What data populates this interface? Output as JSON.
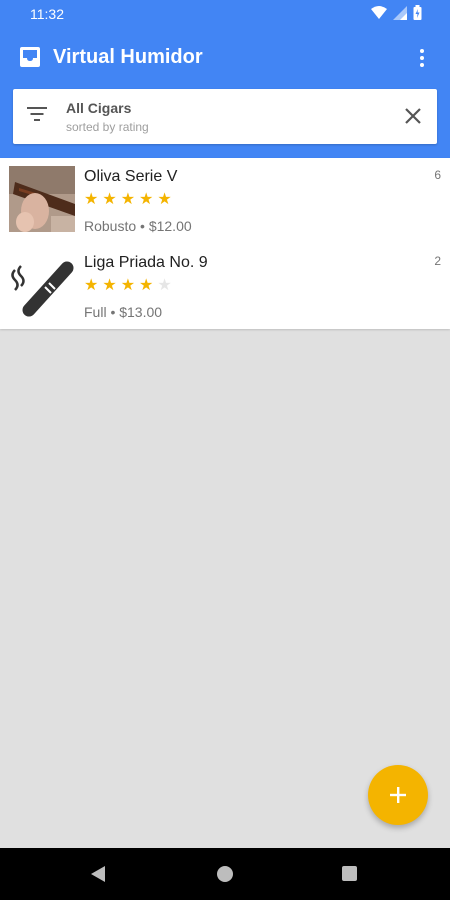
{
  "status_bar": {
    "time": "11:32"
  },
  "app": {
    "title": "Virtual Humidor"
  },
  "filter": {
    "title": "All Cigars",
    "subtitle": "sorted by rating"
  },
  "cigars": [
    {
      "name": "Oliva Serie V",
      "rating": 5,
      "max_rating": 5,
      "meta": "Robusto • $12.00",
      "count": "6",
      "thumbnail": "cigar-photo"
    },
    {
      "name": "Liga Priada No. 9",
      "rating": 4,
      "max_rating": 5,
      "meta": "Full • $13.00",
      "count": "2",
      "thumbnail": "cigar-icon"
    }
  ],
  "colors": {
    "primary": "#4285f4",
    "accent": "#f4b400",
    "background": "#e0e0e0"
  },
  "icons": {
    "app": "inbox-icon",
    "menu": "more-vert-icon",
    "filter": "filter-icon",
    "clear": "close-icon",
    "fab": "plus-icon",
    "star": "star-icon"
  }
}
